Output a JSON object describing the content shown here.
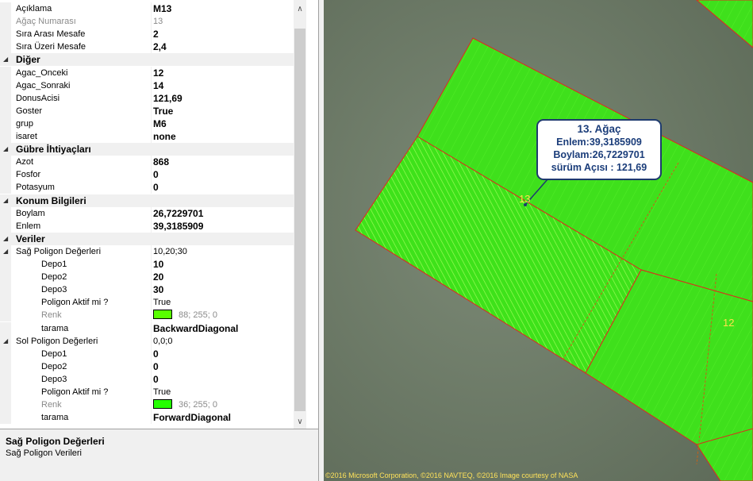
{
  "properties": {
    "rows": [
      {
        "type": "prop",
        "name": "Açıklama",
        "value": "M13",
        "bold": true,
        "indent": 0
      },
      {
        "type": "prop",
        "name": "Ağaç Numarası",
        "value": "13",
        "gray": true,
        "indent": 0
      },
      {
        "type": "prop",
        "name": "Sıra Arası Mesafe",
        "value": "2",
        "bold": true,
        "indent": 0
      },
      {
        "type": "prop",
        "name": "Sıra Üzeri Mesafe",
        "value": "2,4",
        "bold": true,
        "indent": 0
      },
      {
        "type": "cat",
        "name": "Diğer"
      },
      {
        "type": "prop",
        "name": "Agac_Onceki",
        "value": "12",
        "bold": true,
        "indent": 0
      },
      {
        "type": "prop",
        "name": "Agac_Sonraki",
        "value": "14",
        "bold": true,
        "indent": 0
      },
      {
        "type": "prop",
        "name": "DonusAcisi",
        "value": "121,69",
        "bold": true,
        "indent": 0
      },
      {
        "type": "prop",
        "name": "Goster",
        "value": "True",
        "bold": true,
        "indent": 0
      },
      {
        "type": "prop",
        "name": "grup",
        "value": "M6",
        "bold": true,
        "indent": 0
      },
      {
        "type": "prop",
        "name": "isaret",
        "value": "none",
        "bold": true,
        "indent": 0
      },
      {
        "type": "cat",
        "name": "Gübre İhtiyaçları"
      },
      {
        "type": "prop",
        "name": "Azot",
        "value": "868",
        "bold": true,
        "indent": 0
      },
      {
        "type": "prop",
        "name": "Fosfor",
        "value": "0",
        "bold": true,
        "indent": 0
      },
      {
        "type": "prop",
        "name": "Potasyum",
        "value": "0",
        "bold": true,
        "indent": 0
      },
      {
        "type": "cat",
        "name": "Konum Bilgileri"
      },
      {
        "type": "prop",
        "name": "Boylam",
        "value": "26,7229701",
        "bold": true,
        "indent": 0
      },
      {
        "type": "prop",
        "name": "Enlem",
        "value": "39,3185909",
        "bold": true,
        "indent": 0
      },
      {
        "type": "cat",
        "name": "Veriler"
      },
      {
        "type": "prop",
        "name": "Sağ Poligon Değerleri",
        "value": "10,20;30",
        "bold": false,
        "indent": 0,
        "expander": true
      },
      {
        "type": "prop",
        "name": "Depo1",
        "value": "10",
        "bold": true,
        "indent": 1
      },
      {
        "type": "prop",
        "name": "Depo2",
        "value": "20",
        "bold": true,
        "indent": 1
      },
      {
        "type": "prop",
        "name": "Depo3",
        "value": "30",
        "bold": true,
        "indent": 1
      },
      {
        "type": "prop",
        "name": "Poligon Aktif mi ?",
        "value": "True",
        "bold": false,
        "indent": 1
      },
      {
        "type": "prop",
        "name": "Renk",
        "value": "88; 255; 0",
        "gray": true,
        "indent": 1,
        "swatch": "#58ff00"
      },
      {
        "type": "prop",
        "name": "tarama",
        "value": "BackwardDiagonal",
        "bold": true,
        "indent": 1
      },
      {
        "type": "prop",
        "name": "Sol Poligon Değerleri",
        "value": "0,0;0",
        "bold": false,
        "indent": 0,
        "expander": true
      },
      {
        "type": "prop",
        "name": "Depo1",
        "value": "0",
        "bold": true,
        "indent": 1
      },
      {
        "type": "prop",
        "name": "Depo2",
        "value": "0",
        "bold": true,
        "indent": 1
      },
      {
        "type": "prop",
        "name": "Depo3",
        "value": "0",
        "bold": true,
        "indent": 1
      },
      {
        "type": "prop",
        "name": "Poligon Aktif mi ?",
        "value": "True",
        "bold": false,
        "indent": 1
      },
      {
        "type": "prop",
        "name": "Renk",
        "value": "36; 255; 0",
        "gray": true,
        "indent": 1,
        "swatch": "#24ff00"
      },
      {
        "type": "prop",
        "name": "tarama",
        "value": "ForwardDiagonal",
        "bold": true,
        "indent": 1
      }
    ]
  },
  "description": {
    "title": "Sağ Poligon Değerleri",
    "text": "Sağ Poligon Verileri"
  },
  "map": {
    "callout": {
      "line1": "13. Ağaç",
      "line2": "Enlem:39,3185909",
      "line3": "Boylam:26,7229701",
      "line4": "sürüm Açısı : 121,69"
    },
    "labels": {
      "tree13": "13",
      "tree12": "12"
    },
    "copyright": "©2016 Microsoft Corporation, ©2016 NAVTEQ, ©2016 Image courtesy of NASA",
    "colors": {
      "field": "#3ee21a",
      "hatch": "#b8ff70",
      "border": "#e0281e",
      "label": "#ffe14d"
    }
  },
  "scrollbar": {
    "up": "∧",
    "down": "∨"
  }
}
